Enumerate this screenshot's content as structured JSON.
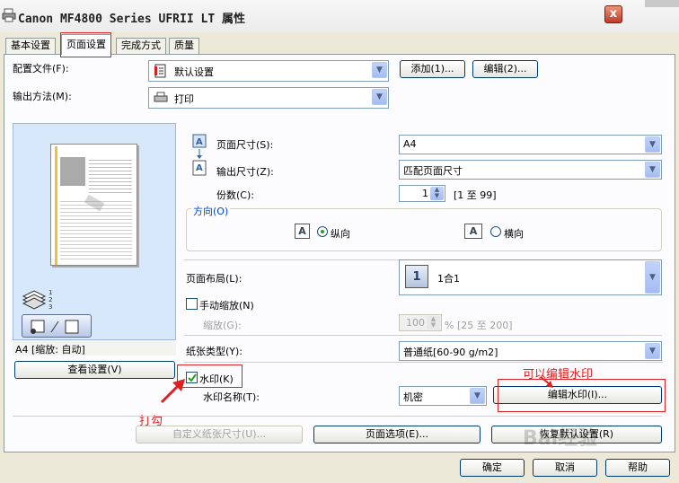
{
  "window": {
    "title": "Canon MF4800 Series UFRII LT 属性",
    "close_label": "x"
  },
  "tabs": [
    {
      "label": "基本设置"
    },
    {
      "label": "页面设置"
    },
    {
      "label": "完成方式"
    },
    {
      "label": "质量"
    }
  ],
  "profile": {
    "label": "配置文件(F):",
    "value": "默认设置",
    "add_label": "添加(1)...",
    "edit_label": "编辑(2)..."
  },
  "output_method": {
    "label": "输出方法(M):",
    "value": "打印"
  },
  "preview": {
    "status": "A4 [缩放: 自动]",
    "view_settings_label": "查看设置(V)",
    "icon_names": [
      "paper-stack-icon",
      "layout-toggle-icon"
    ]
  },
  "page_size": {
    "label": "页面尺寸(S):",
    "value": "A4"
  },
  "output_size": {
    "label": "输出尺寸(Z):",
    "value": "匹配页面尺寸"
  },
  "copies": {
    "label": "份数(C):",
    "value": "1",
    "range": "[1 至 99]"
  },
  "orientation": {
    "label": "方向(O)",
    "portrait": "纵向",
    "landscape": "横向",
    "selected": "portrait"
  },
  "layout": {
    "label": "页面布局(L):",
    "value": "1合1",
    "icon_text": "1"
  },
  "manual_scaling": {
    "label": "手动缩放(N)",
    "checked": false
  },
  "scaling": {
    "label": "缩放(G):",
    "value": "100",
    "range": "% [25 至 200]"
  },
  "paper_type": {
    "label": "纸张类型(Y):",
    "value": "普通纸[60-90 g/m2]"
  },
  "watermark": {
    "checkbox_label": "水印(K)",
    "checked": true,
    "name_label": "水印名称(T):",
    "name_value": "机密",
    "edit_label": "编辑水印(I)..."
  },
  "bottom_buttons": {
    "custom_paper": "自定义纸张尺寸(U)...",
    "page_options": "页面选项(E)...",
    "restore_defaults": "恢复默认设置(R)"
  },
  "dialog_buttons": {
    "ok": "确定",
    "cancel": "取消",
    "help": "帮助"
  },
  "annotations": {
    "check_hint": "打勾",
    "edit_hint": "可以编辑水印",
    "site_watermark": "Bai经验"
  },
  "colors": {
    "annotation_red": "#e02020",
    "accent_blue": "#1c5180"
  }
}
